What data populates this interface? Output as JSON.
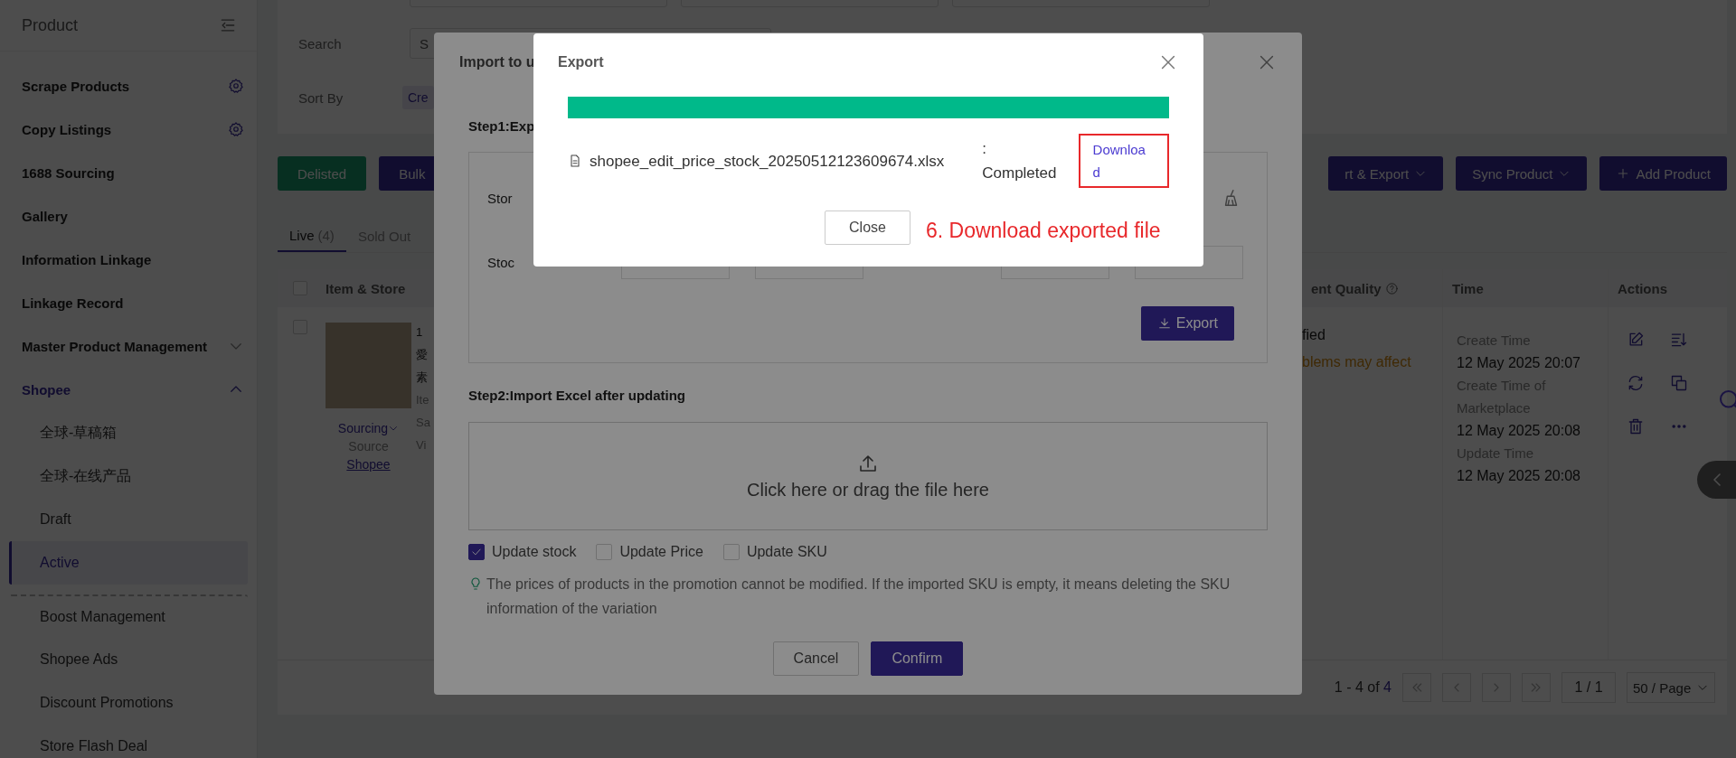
{
  "sidebar": {
    "title": "Product",
    "items": [
      {
        "label": "Scrape Products",
        "kind": "settings",
        "selected": false
      },
      {
        "label": "Copy Listings",
        "kind": "settings",
        "selected": false
      },
      {
        "label": "1688 Sourcing",
        "kind": "link",
        "selected": false
      },
      {
        "label": "Gallery",
        "kind": "link",
        "selected": false
      },
      {
        "label": "Information Linkage",
        "kind": "link",
        "selected": false
      },
      {
        "label": "Linkage Record",
        "kind": "link",
        "selected": false
      },
      {
        "label": "Master Product Management",
        "kind": "group",
        "expanded": false,
        "selected": false
      },
      {
        "label": "Shopee",
        "kind": "group",
        "expanded": true,
        "selected": true,
        "children": [
          {
            "label": "全球-草稿箱",
            "selected": false,
            "separated": false
          },
          {
            "label": "全球-在线产品",
            "selected": false,
            "separated": false
          },
          {
            "label": "Draft",
            "selected": false,
            "separated": false
          },
          {
            "label": "Active",
            "selected": true,
            "separated": false
          },
          {
            "label": "Boost Management",
            "selected": false,
            "separated": true
          },
          {
            "label": "Shopee Ads",
            "selected": false,
            "separated": false
          },
          {
            "label": "Discount Promotions",
            "selected": false,
            "separated": false
          },
          {
            "label": "Store Flash Deal",
            "selected": false,
            "separated": false
          }
        ]
      }
    ]
  },
  "filters": {
    "search_label": "Search",
    "search_placeholder": "S",
    "sort_label": "Sort By",
    "sort_chip": "Cre"
  },
  "toolbar": {
    "left_buttons": [
      {
        "label": "Delisted",
        "kind": "success"
      },
      {
        "label": "Bulk",
        "kind": "primary"
      }
    ],
    "right_buttons": [
      {
        "label": "rt & Export",
        "kind": "dropdown"
      },
      {
        "label": "Sync Product",
        "kind": "dropdown"
      },
      {
        "label": "Add Product",
        "kind": "add"
      }
    ]
  },
  "tabs": [
    {
      "label": "Live",
      "count": "(4)",
      "selected": true
    },
    {
      "label": "Sold Out",
      "selected": false
    }
  ],
  "table": {
    "columns": [
      {
        "label": "Item & Store",
        "kind": "plain"
      },
      {
        "label": "ent Quality",
        "kind": "help"
      },
      {
        "label": "Time",
        "kind": "plain"
      },
      {
        "label": "Actions",
        "kind": "plain"
      }
    ],
    "header_checked": false,
    "rows": [
      {
        "selected": false,
        "title_fragments": [
          "1",
          "愛",
          "素"
        ],
        "meta_fragments": [
          "Ite",
          "Sa",
          "Vi"
        ],
        "sourcing": "Sourcing",
        "source_label": "Source",
        "source_link": "Shopee",
        "quality_status": "fied",
        "quality_warning": "blems may affect",
        "times": [
          {
            "label": "Create Time",
            "value": "12 May 2025 20:07"
          },
          {
            "label": "Create Time of Marketplace",
            "value": "12 May 2025 20:08"
          },
          {
            "label": "Update Time",
            "value": "12 May 2025 20:08"
          }
        ]
      }
    ]
  },
  "pagination": {
    "summary": "1 - 4 of",
    "total": "4",
    "page": "1 / 1",
    "page_size": "50 / Page"
  },
  "import_dialog": {
    "title": "Import to u",
    "step1": "Step1:Exp",
    "store_label": "Stor",
    "stock_label": "Stoc",
    "export_button": "Export",
    "step2": "Step2:Import Excel after updating",
    "upload_text": "Click here or drag the file here",
    "options": [
      {
        "label": "Update stock",
        "checked": true
      },
      {
        "label": "Update Price",
        "checked": false
      },
      {
        "label": "Update SKU",
        "checked": false
      }
    ],
    "hint": "The prices of products in the promotion cannot be modified. If the imported SKU is empty, it means deleting the SKU information of the variation",
    "buttons": [
      {
        "label": "Cancel",
        "kind": "default"
      },
      {
        "label": "Confirm",
        "kind": "primary"
      }
    ]
  },
  "export_dialog": {
    "title": "Export",
    "progress": {
      "level": 1
    },
    "file": {
      "name": "shopee_edit_price_stock_20250512123609674.xlsx",
      "status": ": Completed",
      "action": "Download"
    },
    "close_button": "Close"
  },
  "annotation": {
    "text": "6. Download exported file"
  }
}
